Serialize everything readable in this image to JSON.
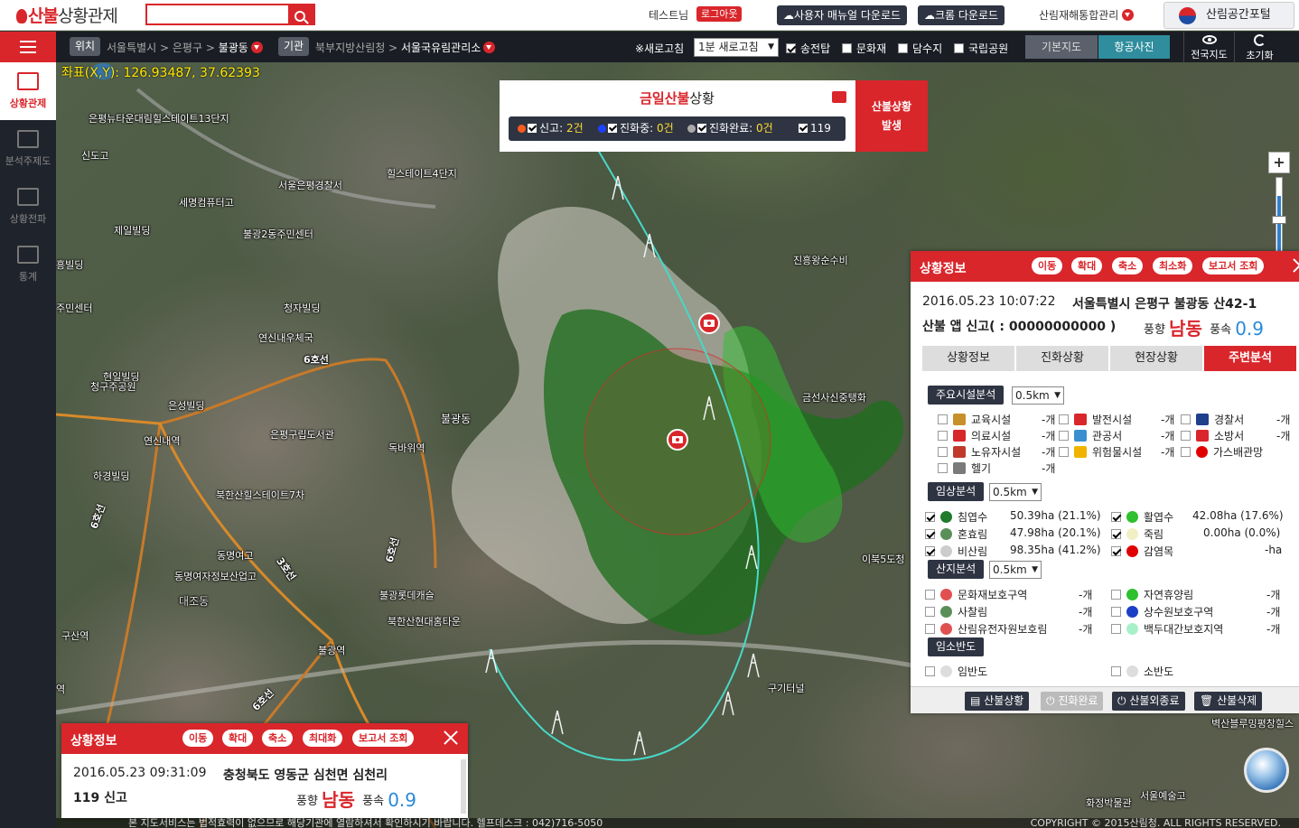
{
  "header": {
    "logo_brand": "산불",
    "logo_rest": "상황관제",
    "search_placeholder": "",
    "user_name": "테스트님",
    "logout_label": "로그아웃",
    "manual_download_label": "사용자 매뉴얼 다운로드",
    "chrome_download_label": "크롬 다운로드",
    "management_menu_label": "산림재해통합관리",
    "portal_label": "산림공간포털"
  },
  "navbar": {
    "location_tag": "위치",
    "location_crumbs": [
      "서울특별시",
      "은평구",
      "불광동"
    ],
    "agency_tag": "기관",
    "agency_crumbs": [
      "북부지방산림청",
      "서울국유림관리소"
    ],
    "refresh_label": "※새로고침",
    "refresh_value": "1분 새로고침",
    "layers": [
      {
        "label": "송전탑",
        "checked": true
      },
      {
        "label": "문화재",
        "checked": false
      },
      {
        "label": "담수지",
        "checked": false
      },
      {
        "label": "국립공원",
        "checked": false
      }
    ],
    "basemap_label": "기본지도",
    "aerial_label": "항공사진",
    "nationwide_label": "전국지도",
    "reset_label": "초기화"
  },
  "sidebar": {
    "items": [
      {
        "label": "상황관제",
        "active": true
      },
      {
        "label": "분석주제도",
        "active": false
      },
      {
        "label": "상황전파",
        "active": false
      },
      {
        "label": "통계",
        "active": false
      }
    ]
  },
  "map": {
    "coords_label": "좌표(X,Y):",
    "coords_value": "126.93487, 37.62393",
    "labels": {
      "l1": "은평뉴타운대림힐스테이트13단지",
      "l2": "신도고",
      "l3": "힐스테이트4단지",
      "l4": "서울은평경찰서",
      "l5": "세명컴퓨터고",
      "l6": "제일빌딩",
      "l7": "불광2동주민센터",
      "l8": "진흥왕순수비",
      "l9": "흥빌딩",
      "l10": "청자빌딩",
      "l11": "주민센터",
      "l12": "연신내우체국",
      "l13": "6호선",
      "l14": "현일빌딩",
      "l15": "청구주공원",
      "l16": "은성빌딩",
      "l17": "금선사신중탱화",
      "l18": "불광동",
      "l19": "연신내역",
      "l20": "은평구립도서관",
      "l21": "독바위역",
      "l22": "하경빌딩",
      "l23": "북한산힐스테이트7차",
      "l24": "6호선",
      "l25": "동명여고",
      "l26": "동명여자정보산업고",
      "l27": "3호선",
      "l28": "6호선",
      "l29": "대조동",
      "l30": "불광롯데캐슬",
      "l31": "북한산현대홈타운",
      "l32": "구산역",
      "l33": "불광역",
      "l34": "이북5도청",
      "l35": "구기터널",
      "l36": "6호선",
      "l37": "역",
      "l38": "벽산블루밍평창힐스",
      "l39": "화정박물관",
      "l40": "서울예술고"
    }
  },
  "situation": {
    "title_red": "금일산불",
    "title_rest": "상황",
    "report_label": "신고:",
    "report_count": "2건",
    "progress_label": "진화중:",
    "progress_count": "0건",
    "done_label": "진화완료:",
    "done_count": "0건",
    "label_119": "119",
    "occur_button_line1": "산불상황",
    "occur_button_line2": "발생"
  },
  "right_panel": {
    "title": "상황정보",
    "pills": [
      "이동",
      "확대",
      "축소",
      "최소화",
      "보고서 조회"
    ],
    "datetime": "2016.05.23 10:07:22",
    "address": "서울특별시 은평구 불광동 산42-1",
    "report_type": "산불 앱 신고( : 00000000000 )",
    "wind_dir_label": "풍향",
    "wind_dir": "남동",
    "wind_speed_label": "풍속",
    "wind_speed": "0.9",
    "tabs": [
      {
        "label": "상황정보",
        "active": false
      },
      {
        "label": "진화상황",
        "active": false
      },
      {
        "label": "현장상황",
        "active": false
      },
      {
        "label": "주변분석",
        "active": true
      }
    ],
    "facility_head": "주요시설분석",
    "facility_radius": "0.5km",
    "facilities": [
      {
        "label": "교육시설",
        "value": "-개",
        "color": "#c8902a"
      },
      {
        "label": "발전시설",
        "value": "-개",
        "color": "#d9262b"
      },
      {
        "label": "경찰서",
        "value": "-개",
        "color": "#1e3f8c"
      },
      {
        "label": "의료시설",
        "value": "-개",
        "color": "#d9262b"
      },
      {
        "label": "관공서",
        "value": "-개",
        "color": "#3a8fd0"
      },
      {
        "label": "소방서",
        "value": "-개",
        "color": "#d9262b"
      },
      {
        "label": "노유자시설",
        "value": "-개",
        "color": "#c0392b"
      },
      {
        "label": "위험물시설",
        "value": "-개",
        "color": "#f0b400"
      },
      {
        "label": "가스배관망",
        "value": "",
        "color": "#e00000"
      },
      {
        "label": "헬기",
        "value": "-개",
        "color": "#7a7a7a"
      }
    ],
    "forest_head": "임상분석",
    "forest_radius": "0.5km",
    "forests": [
      {
        "label": "침엽수",
        "value": "50.39ha (21.1%)",
        "color": "#1f7a2b",
        "checked": true
      },
      {
        "label": "활엽수",
        "value": "42.08ha (17.6%)",
        "color": "#2ec02e",
        "checked": true
      },
      {
        "label": "혼효림",
        "value": "47.98ha (20.1%)",
        "color": "#5a8f5a",
        "checked": true
      },
      {
        "label": "죽림",
        "value": "0.00ha (0.0%)",
        "color": "#f3efc4",
        "checked": true
      },
      {
        "label": "비산림",
        "value": "98.35ha (41.2%)",
        "color": "#cccccc",
        "checked": true
      },
      {
        "label": "감염목",
        "value": "-ha",
        "color": "#e00000",
        "checked": true
      }
    ],
    "mountain_head": "산지분석",
    "mountain_radius": "0.5km",
    "mountains": [
      {
        "label": "문화재보호구역",
        "value": "-개",
        "color": "#e05050"
      },
      {
        "label": "자연휴양림",
        "value": "-개",
        "color": "#2ec02e"
      },
      {
        "label": "사찰림",
        "value": "-개",
        "color": "#5a8f5a"
      },
      {
        "label": "상수원보호구역",
        "value": "-개",
        "color": "#1c3fc8"
      },
      {
        "label": "산림유전자원보호림",
        "value": "-개",
        "color": "#e05050"
      },
      {
        "label": "백두대간보호지역",
        "value": "-개",
        "color": "#a8f0c8"
      }
    ],
    "density_head": "임소반도",
    "densities": [
      {
        "label": "임반도",
        "color": "#dddddd"
      },
      {
        "label": "소반도",
        "color": "#dddddd"
      }
    ],
    "footer_buttons": [
      {
        "label": "산불상황",
        "dim": false
      },
      {
        "label": "진화완료",
        "dim": true
      },
      {
        "label": "산불외종료",
        "dim": false
      },
      {
        "label": "산불삭제",
        "dim": false
      }
    ]
  },
  "left_panel": {
    "title": "상황정보",
    "pills": [
      "이동",
      "확대",
      "축소",
      "최대화",
      "보고서 조회"
    ],
    "datetime": "2016.05.23 09:31:09",
    "address": "충청북도 영동군 심천면 심천리",
    "report_type": "119 신고",
    "wind_dir_label": "풍향",
    "wind_dir": "남동",
    "wind_speed_label": "풍속",
    "wind_speed": "0.9"
  },
  "footer": {
    "notice": "본 지도서비스는 법적효력이 없으므로 해당기관에 열람하셔서 확인하시기 바랍니다. 헬프데스크 : 042)716-5050",
    "copyright": "COPYRIGHT © 2015산림청. ALL RIGHTS RESERVED."
  },
  "colors": {
    "brand_red": "#d9262b",
    "dark_navy": "#2e3442",
    "aerial_teal": "#2f8d9d",
    "wind_blue": "#2a89d8"
  }
}
